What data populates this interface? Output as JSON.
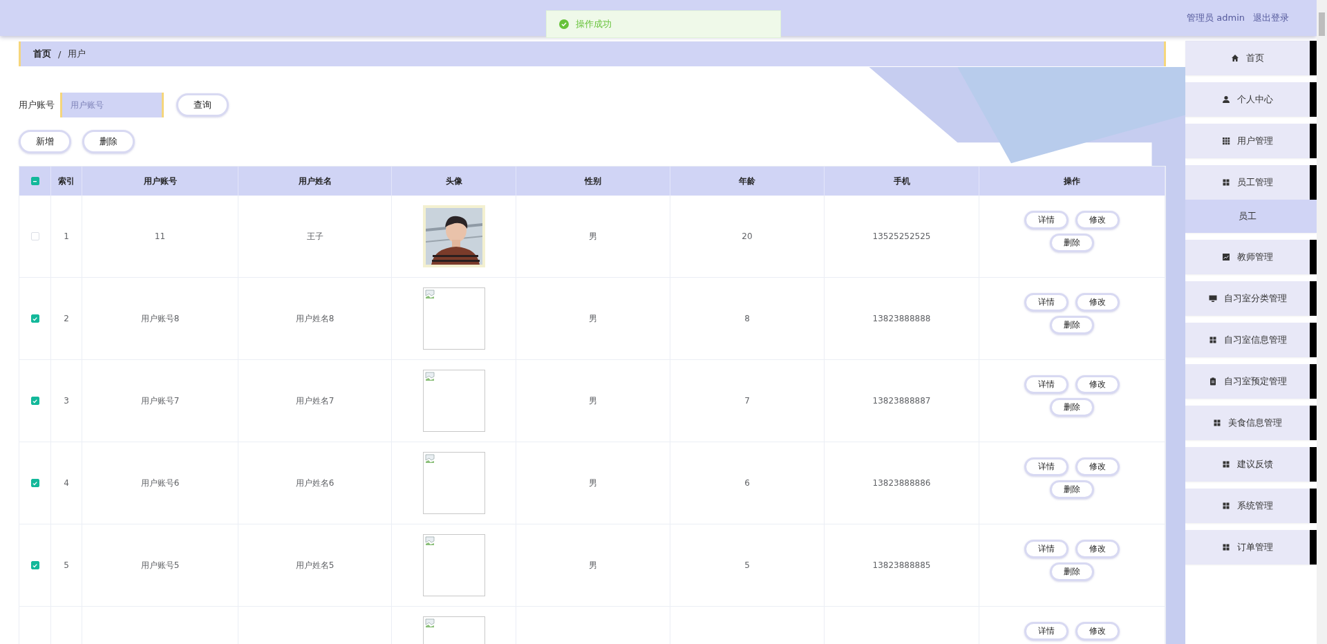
{
  "toast": {
    "message": "操作成功"
  },
  "header": {
    "user": "管理员 admin",
    "logout": "退出登录"
  },
  "breadcrumb": {
    "items": [
      "首页",
      "用户"
    ],
    "separator": "/"
  },
  "search": {
    "label": "用户账号",
    "placeholder": "用户账号",
    "button": "查询"
  },
  "actions": [
    "新增",
    "删除"
  ],
  "table": {
    "select_all": {
      "indeterminate": true
    },
    "columns": [
      "索引",
      "用户账号",
      "用户姓名",
      "头像",
      "性别",
      "年龄",
      "手机",
      "操作"
    ],
    "rows": [
      {
        "checked": false,
        "index": "1",
        "account": "11",
        "name": "王子",
        "gender": "男",
        "age": "20",
        "phone": "13525252525",
        "buttons": [
          "详情",
          "修改",
          "删除"
        ]
      },
      {
        "checked": true,
        "index": "2",
        "account": "用户账号8",
        "name": "用户姓名8",
        "avatar": {
          "kind": "broken"
        },
        "gender": "男",
        "age": "8",
        "phone": "13823888888",
        "buttons": [
          "详情",
          "修改",
          "删除"
        ]
      },
      {
        "checked": true,
        "index": "3",
        "account": "用户账号7",
        "name": "用户姓名7",
        "avatar": {
          "kind": "broken"
        },
        "gender": "男",
        "age": "7",
        "phone": "13823888887",
        "buttons": [
          "详情",
          "修改",
          "删除"
        ]
      },
      {
        "checked": true,
        "index": "4",
        "account": "用户账号6",
        "name": "用户姓名6",
        "avatar": {
          "kind": "broken"
        },
        "gender": "男",
        "age": "6",
        "phone": "13823888886",
        "buttons": [
          "详情",
          "修改",
          "删除"
        ]
      },
      {
        "checked": true,
        "index": "5",
        "account": "用户账号5",
        "name": "用户姓名5",
        "avatar": {
          "kind": "broken"
        },
        "gender": "男",
        "age": "5",
        "phone": "13823888885",
        "buttons": [
          "详情",
          "修改",
          "删除"
        ]
      },
      {
        "avatar": {
          "kind": "broken"
        },
        "buttons": [
          "详情",
          "修改"
        ]
      }
    ]
  },
  "sidebar": {
    "items": [
      {
        "label": "首页",
        "selected": false
      },
      {
        "label": "个人中心",
        "selected": false
      },
      {
        "label": "用户管理",
        "selected": false
      },
      {
        "label": "员工管理",
        "selected": false,
        "expanded": true,
        "children": [
          {
            "label": "员工",
            "selected": true
          }
        ]
      },
      {
        "label": "教师管理",
        "selected": false
      },
      {
        "label": "自习室分类管理",
        "selected": false
      },
      {
        "label": "自习室信息管理",
        "selected": false
      },
      {
        "label": "自习室预定管理",
        "selected": false
      },
      {
        "label": "美食信息管理",
        "selected": false
      },
      {
        "label": "建议反馈",
        "selected": false
      },
      {
        "label": "系统管理",
        "selected": false
      },
      {
        "label": "订单管理",
        "selected": false
      }
    ]
  }
}
